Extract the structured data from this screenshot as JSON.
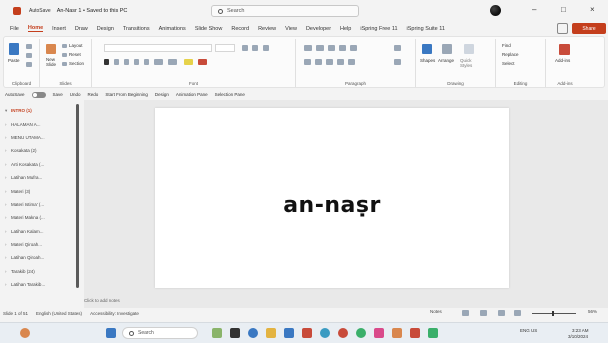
{
  "titlebar": {
    "autosave_label": "AutoSave",
    "document_title": "An-Nasr 1 • Saved to this PC",
    "search_placeholder": "Search",
    "minimize": "–",
    "maximize": "□",
    "close": "×"
  },
  "tabs": [
    "File",
    "Home",
    "Insert",
    "Draw",
    "Design",
    "Transitions",
    "Animations",
    "Slide Show",
    "Record",
    "Review",
    "View",
    "Developer",
    "Help",
    "iSpring Free 11",
    "iSpring Suite 11"
  ],
  "active_tab": "Home",
  "share_label": "Share",
  "ribbon": {
    "groups": [
      "Clipboard",
      "Slides",
      "Font",
      "Paragraph",
      "Drawing",
      "Editing",
      "Add-ins"
    ],
    "paste": "Paste",
    "new_slide": "New Slide",
    "layout": "Layout",
    "reset": "Reset",
    "section": "Section",
    "shapes": "Shapes",
    "arrange": "Arrange",
    "quick_styles": "Quick Styles",
    "find": "Find",
    "replace": "Replace",
    "select": "Select",
    "addins": "Add-ins"
  },
  "toolbar2": [
    "AutoSave",
    "Save",
    "Undo",
    "Redo",
    "Start From Beginning",
    "Design",
    "Animation Pane",
    "Selection Pane"
  ],
  "slides": [
    {
      "label": "INTRO (1)",
      "current": true
    },
    {
      "label": "HALAMAN A...",
      "current": false
    },
    {
      "label": "MENU UTAMA...",
      "current": false
    },
    {
      "label": "Kosakata (2)",
      "current": false
    },
    {
      "label": "Arti Kosakata (...",
      "current": false
    },
    {
      "label": "Latihan Mufra...",
      "current": false
    },
    {
      "label": "Materi (3)",
      "current": false
    },
    {
      "label": "Materi Istima' (...",
      "current": false
    },
    {
      "label": "Materi Makna (...",
      "current": false
    },
    {
      "label": "Latihan Kalam...",
      "current": false
    },
    {
      "label": "Materi Qiroah...",
      "current": false
    },
    {
      "label": "Latihan Qiroah...",
      "current": false
    },
    {
      "label": "Tarakib (24)",
      "current": false
    },
    {
      "label": "Latihan Tarakib...",
      "current": false
    }
  ],
  "slide_title": "an-naṣr",
  "notes_placeholder": "Click to add notes",
  "status": {
    "slide_counter": "Slide 1 of 51",
    "language": "English (United States)",
    "accessibility": "Accessibility: Investigate",
    "notes": "Notes",
    "zoom": "56%"
  },
  "taskbar": {
    "search_label": "Search",
    "time": "3:23 AM",
    "date": "3/10/2024",
    "lang": "ENG US"
  }
}
